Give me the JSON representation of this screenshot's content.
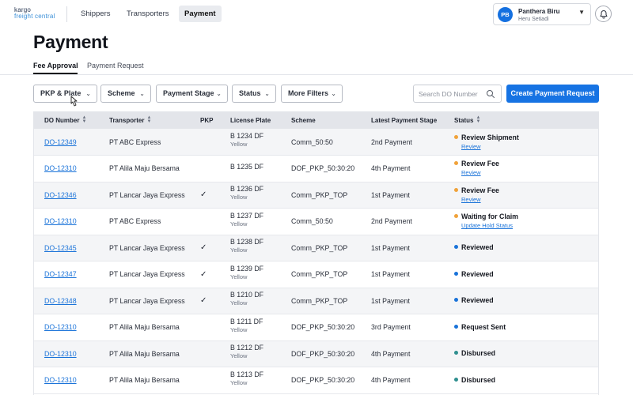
{
  "logo": {
    "line1": "kargo",
    "line2": "freight central"
  },
  "nav": [
    {
      "label": "Shippers"
    },
    {
      "label": "Transporters"
    },
    {
      "label": "Payment"
    }
  ],
  "user": {
    "initials": "PB",
    "name": "Panthera Biru",
    "subtitle": "Heru Setiadi"
  },
  "page": {
    "title": "Payment"
  },
  "tabs": [
    {
      "label": "Fee Approval"
    },
    {
      "label": "Payment Request"
    }
  ],
  "filters": [
    {
      "label": "PKP & Plate"
    },
    {
      "label": "Scheme"
    },
    {
      "label": "Payment Stage"
    },
    {
      "label": "Status"
    },
    {
      "label": "More Filters"
    }
  ],
  "search": {
    "placeholder": "Search DO Number",
    "value": ""
  },
  "create_button": {
    "label": "Create Payment Request"
  },
  "table": {
    "columns": [
      "DO Number",
      "Transporter",
      "PKP",
      "License Plate",
      "Scheme",
      "Latest Payment Stage",
      "Status"
    ],
    "rows": [
      {
        "do": "DO-12349",
        "transporter": "PT ABC Express",
        "pkp": "",
        "plate": "B 1234 DF",
        "plate_color": "Yellow",
        "scheme": "Comm_50:50",
        "stage": "2nd Payment",
        "status": "Review Shipment",
        "status_color": "#f0a23a",
        "action": "Review"
      },
      {
        "do": "DO-12310",
        "transporter": "PT Alila Maju Bersama",
        "pkp": "",
        "plate": "B 1235 DF",
        "plate_color": "",
        "scheme": "DOF_PKP_50:30:20",
        "stage": "4th Payment",
        "status": "Review Fee",
        "status_color": "#f0a23a",
        "action": "Review"
      },
      {
        "do": "DO-12346",
        "transporter": "PT Lancar Jaya Express",
        "pkp": "✓",
        "plate": "B 1236 DF",
        "plate_color": "Yellow",
        "scheme": "Comm_PKP_TOP",
        "stage": "1st Payment",
        "status": "Review Fee",
        "status_color": "#f0a23a",
        "action": "Review"
      },
      {
        "do": "DO-12310",
        "transporter": "PT ABC Express",
        "pkp": "",
        "plate": "B 1237 DF",
        "plate_color": "Yellow",
        "scheme": "Comm_50:50",
        "stage": "2nd Payment",
        "status": "Waiting for Claim",
        "status_color": "#f0a23a",
        "action": "Update Hold Status"
      },
      {
        "do": "DO-12345",
        "transporter": "PT Lancar Jaya Express",
        "pkp": "✓",
        "plate": "B 1238 DF",
        "plate_color": "Yellow",
        "scheme": "Comm_PKP_TOP",
        "stage": "1st Payment",
        "status": "Reviewed",
        "status_color": "#1a73d9",
        "action": ""
      },
      {
        "do": "DO-12347",
        "transporter": "PT Lancar Jaya Express",
        "pkp": "✓",
        "plate": "B 1239 DF",
        "plate_color": "Yellow",
        "scheme": "Comm_PKP_TOP",
        "stage": "1st Payment",
        "status": "Reviewed",
        "status_color": "#1a73d9",
        "action": ""
      },
      {
        "do": "DO-12348",
        "transporter": "PT Lancar Jaya Express",
        "pkp": "✓",
        "plate": "B 1210 DF",
        "plate_color": "Yellow",
        "scheme": "Comm_PKP_TOP",
        "stage": "1st Payment",
        "status": "Reviewed",
        "status_color": "#1a73d9",
        "action": ""
      },
      {
        "do": "DO-12310",
        "transporter": "PT Alila Maju Bersama",
        "pkp": "",
        "plate": "B 1211 DF",
        "plate_color": "Yellow",
        "scheme": "DOF_PKP_50:30:20",
        "stage": "3rd Payment",
        "status": "Request Sent",
        "status_color": "#1a73d9",
        "action": ""
      },
      {
        "do": "DO-12310",
        "transporter": "PT Alila Maju Bersama",
        "pkp": "",
        "plate": "B 1212 DF",
        "plate_color": "Yellow",
        "scheme": "DOF_PKP_50:30:20",
        "stage": "4th Payment",
        "status": "Disbursed",
        "status_color": "#2f8f8f",
        "action": ""
      },
      {
        "do": "DO-12310",
        "transporter": "PT Alila Maju Bersama",
        "pkp": "",
        "plate": "B 1213 DF",
        "plate_color": "Yellow",
        "scheme": "DOF_PKP_50:30:20",
        "stage": "4th Payment",
        "status": "Disbursed",
        "status_color": "#2f8f8f",
        "action": ""
      }
    ]
  }
}
